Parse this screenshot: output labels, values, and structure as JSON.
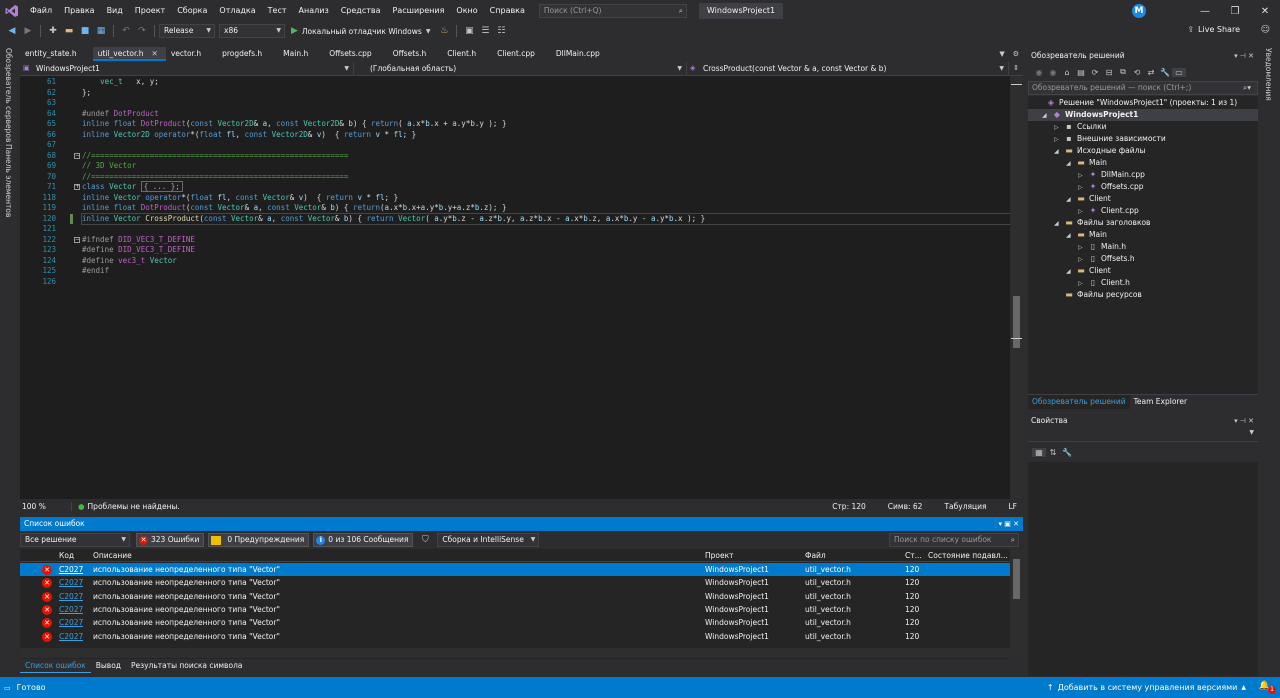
{
  "titlebar": {
    "menu": [
      "Файл",
      "Правка",
      "Вид",
      "Проект",
      "Сборка",
      "Отладка",
      "Тест",
      "Анализ",
      "Средства",
      "Расширения",
      "Окно",
      "Справка"
    ],
    "search_placeholder": "Поиск (Ctrl+Q)",
    "window_title": "WindowsProject1",
    "avatar_letter": "M"
  },
  "toolbar": {
    "configuration": "Release",
    "platform": "x86",
    "debugger": "Локальный отладчик Windows",
    "live_share": "Live Share"
  },
  "left_strip": {
    "server_explorer": "Обозреватель серверов",
    "toolbox": "Панель элементов"
  },
  "right_strip": {
    "label": "Уведомления"
  },
  "doc_tabs": [
    {
      "label": "entity_state.h",
      "active": false
    },
    {
      "label": "util_vector.h",
      "active": true
    },
    {
      "label": "vector.h",
      "active": false
    },
    {
      "label": "progdefs.h",
      "active": false
    },
    {
      "label": "Main.h",
      "active": false
    },
    {
      "label": "Offsets.cpp",
      "active": false
    },
    {
      "label": "Offsets.h",
      "active": false
    },
    {
      "label": "Client.h",
      "active": false
    },
    {
      "label": "Client.cpp",
      "active": false
    },
    {
      "label": "DllMain.cpp",
      "active": false
    }
  ],
  "navbar": {
    "project": "WindowsProject1",
    "scope": "(Глобальная область)",
    "member": "CrossProduct(const Vector & a, const Vector & b)"
  },
  "editor": {
    "lines": [
      {
        "num": "61",
        "html": "    <span class=\"ty\">vec_t</span>   x, y;"
      },
      {
        "num": "62",
        "html": "};"
      },
      {
        "num": "63",
        "html": ""
      },
      {
        "num": "64",
        "html": "<span class=\"pp\">#undef</span> <span class=\"mac\">DotProduct</span>"
      },
      {
        "num": "65",
        "html": "<span class=\"kw\">inline</span> <span class=\"kw\">float</span> <span class=\"mac\">DotProduct</span>(<span class=\"kw\">const</span> <span class=\"ty\">Vector2D</span>&amp; <span class=\"par\">a</span>, <span class=\"kw\">const</span> <span class=\"ty\">Vector2D</span>&amp; <span class=\"par\">b</span>) { <span class=\"kw\">return</span>( <span class=\"par\">a</span>.x*<span class=\"par\">b</span>.x + <span class=\"par\">a</span>.y*<span class=\"par\">b</span>.y ); }"
      },
      {
        "num": "66",
        "html": "<span class=\"kw\">inline</span> <span class=\"ty\">Vector2D</span> <span class=\"kw\">operator</span>*(<span class=\"kw\">float</span> <span class=\"par\">fl</span>, <span class=\"kw\">const</span> <span class=\"ty\">Vector2D</span>&amp; <span class=\"par\">v</span>)  { <span class=\"kw\">return</span> <span class=\"par\">v</span> * <span class=\"par\">fl</span>; }"
      },
      {
        "num": "67",
        "html": ""
      },
      {
        "num": "68",
        "html": "<span class=\"cm\">//=========================================================</span>"
      },
      {
        "num": "69",
        "html": "<span class=\"cm\">// 3D Vector</span>"
      },
      {
        "num": "70",
        "html": "<span class=\"cm\">//=========================================================</span>"
      },
      {
        "num": "71",
        "html": "<span class=\"kw\">class</span> <span class=\"ty\">Vector</span> <span class=\"collapsed\">{ ... };</span>"
      },
      {
        "num": "118",
        "html": "<span class=\"kw\">inline</span> <span class=\"ty\">Vector</span> <span class=\"kw\">operator</span>*(<span class=\"kw\">float</span> <span class=\"par\">fl</span>, <span class=\"kw\">const</span> <span class=\"ty\">Vector</span>&amp; <span class=\"par\">v</span>)  { <span class=\"kw\">return</span> <span class=\"par\">v</span> * <span class=\"par\">fl</span>; }"
      },
      {
        "num": "119",
        "html": "<span class=\"kw\">inline</span> <span class=\"kw\">float</span> <span class=\"mac\">DotProduct</span>(<span class=\"kw\">const</span> <span class=\"ty\">Vector</span>&amp; <span class=\"par\">a</span>, <span class=\"kw\">const</span> <span class=\"ty\">Vector</span>&amp; <span class=\"par\">b</span>) { <span class=\"kw\">return</span>(<span class=\"par\">a</span>.x*<span class=\"par\">b</span>.x+<span class=\"par\">a</span>.y*<span class=\"par\">b</span>.y+<span class=\"par\">a</span>.z*<span class=\"par\">b</span>.z); }"
      },
      {
        "num": "120",
        "html": "<span class=\"kw\">inline</span> <span class=\"ty\">Vector</span> <span class=\"fn\">CrossProduct</span>(<span class=\"kw\">const</span> <span class=\"ty\">Vector</span>&amp; <span class=\"par\">a</span>, <span class=\"kw\">const</span> <span class=\"ty\">Vector</span>&amp; <span class=\"par\">b</span>) { <span class=\"kw\">return</span> <span class=\"ty\">Vector</span>( <span class=\"par\">a</span>.y*<span class=\"par\">b</span>.z - <span class=\"par\">a</span>.z*<span class=\"par\">b</span>.y, <span class=\"par\">a</span>.z*<span class=\"par\">b</span>.x - <span class=\"par\">a</span>.x*<span class=\"par\">b</span>.z, <span class=\"par\">a</span>.x*<span class=\"par\">b</span>.y - <span class=\"par\">a</span>.y*<span class=\"par\">b</span>.x ); }"
      },
      {
        "num": "121",
        "html": ""
      },
      {
        "num": "122",
        "html": "<span class=\"pp\">#ifndef</span> <span class=\"mac\">DID_VEC3_T_DEFINE</span>"
      },
      {
        "num": "123",
        "html": "<span class=\"pp\">#define</span> <span class=\"mac\">DID_VEC3_T_DEFINE</span>"
      },
      {
        "num": "124",
        "html": "<span class=\"pp\">#define</span> <span class=\"mac\">vec3_t</span> <span class=\"ty\">Vector</span>"
      },
      {
        "num": "125",
        "html": "<span class=\"pp\">#endif</span>"
      },
      {
        "num": "126",
        "html": ""
      }
    ]
  },
  "editor_status": {
    "zoom": "100 %",
    "issues": "Проблемы не найдены.",
    "line": "Стр: 120",
    "col": "Симв: 62",
    "tabs": "Табуляция",
    "eol": "LF"
  },
  "error_list": {
    "title": "Список ошибок",
    "scope": "Все решение",
    "errors_btn": "323 Ошибки",
    "warnings_btn": "0 Предупреждения",
    "messages_btn": "0 из 106 Сообщения",
    "build_filter": "Сборка и IntelliSense",
    "search_placeholder": "Поиск по списку ошибок",
    "columns": {
      "code": "Код",
      "description": "Описание",
      "project": "Проект",
      "file": "Файл",
      "line": "Ст...",
      "state": "Состояние подавл..."
    },
    "rows": [
      {
        "code": "C2027",
        "description": "использование неопределенного типа \"Vector\"",
        "project": "WindowsProject1",
        "file": "util_vector.h",
        "line": "120"
      },
      {
        "code": "C2027",
        "description": "использование неопределенного типа \"Vector\"",
        "project": "WindowsProject1",
        "file": "util_vector.h",
        "line": "120"
      },
      {
        "code": "C2027",
        "description": "использование неопределенного типа \"Vector\"",
        "project": "WindowsProject1",
        "file": "util_vector.h",
        "line": "120"
      },
      {
        "code": "C2027",
        "description": "использование неопределенного типа \"Vector\"",
        "project": "WindowsProject1",
        "file": "util_vector.h",
        "line": "120"
      },
      {
        "code": "C2027",
        "description": "использование неопределенного типа \"Vector\"",
        "project": "WindowsProject1",
        "file": "util_vector.h",
        "line": "120"
      },
      {
        "code": "C2027",
        "description": "использование неопределенного типа \"Vector\"",
        "project": "WindowsProject1",
        "file": "util_vector.h",
        "line": "120"
      }
    ]
  },
  "bottom_tabs": [
    "Список ошибок",
    "Вывод",
    "Результаты поиска символа"
  ],
  "solution_explorer": {
    "title": "Обозреватель решений",
    "search_placeholder": "Обозреватель решений — поиск (Ctrl+;)",
    "tree": [
      {
        "label": "Решение \"WindowsProject1\" (проекты: 1 из 1)",
        "level": 0,
        "icon": "sln",
        "exp": ""
      },
      {
        "label": "WindowsProject1",
        "level": 1,
        "icon": "proj",
        "exp": "◢",
        "bold": true,
        "sel": true
      },
      {
        "label": "Ссылки",
        "level": 2,
        "icon": "ref",
        "exp": "▷"
      },
      {
        "label": "Внешние зависимости",
        "level": 2,
        "icon": "ref",
        "exp": "▷"
      },
      {
        "label": "Исходные файлы",
        "level": 2,
        "icon": "folder",
        "exp": "◢"
      },
      {
        "label": "Main",
        "level": 3,
        "icon": "folder",
        "exp": "◢"
      },
      {
        "label": "DllMain.cpp",
        "level": 4,
        "icon": "cpp",
        "exp": "▷"
      },
      {
        "label": "Offsets.cpp",
        "level": 4,
        "icon": "cpp",
        "exp": "▷"
      },
      {
        "label": "Client",
        "level": 3,
        "icon": "folder",
        "exp": "◢"
      },
      {
        "label": "Client.cpp",
        "level": 4,
        "icon": "cpp",
        "exp": "▷"
      },
      {
        "label": "Файлы заголовков",
        "level": 2,
        "icon": "folder",
        "exp": "◢"
      },
      {
        "label": "Main",
        "level": 3,
        "icon": "folder",
        "exp": "◢"
      },
      {
        "label": "Main.h",
        "level": 4,
        "icon": "h",
        "exp": "▷"
      },
      {
        "label": "Offsets.h",
        "level": 4,
        "icon": "h",
        "exp": "▷"
      },
      {
        "label": "Client",
        "level": 3,
        "icon": "folder",
        "exp": "◢"
      },
      {
        "label": "Client.h",
        "level": 4,
        "icon": "h",
        "exp": "▷"
      },
      {
        "label": "Файлы ресурсов",
        "level": 2,
        "icon": "folder",
        "exp": ""
      }
    ],
    "tabs": [
      "Обозреватель решений",
      "Team Explorer"
    ]
  },
  "properties": {
    "title": "Свойства"
  },
  "statusbar": {
    "ready": "Готово",
    "vcs": "Добавить в систему управления версиями",
    "notifications": "1"
  }
}
